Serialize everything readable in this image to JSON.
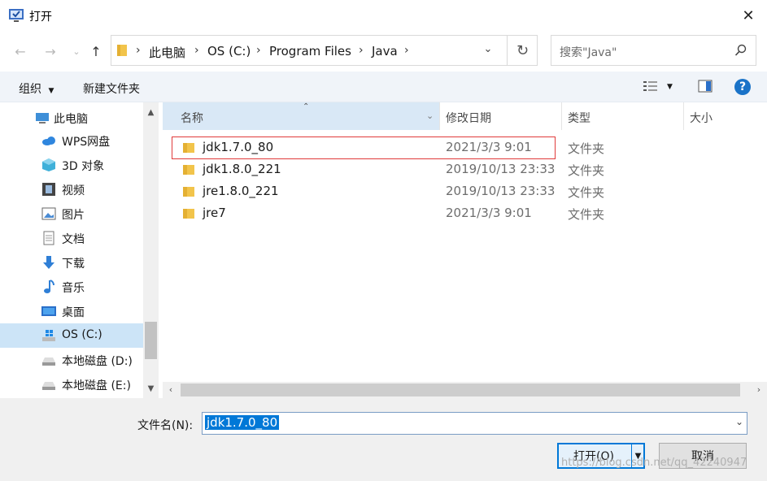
{
  "window": {
    "title": "打开"
  },
  "address": {
    "crumbs": [
      "此电脑",
      "OS (C:)",
      "Program Files",
      "Java"
    ]
  },
  "search": {
    "placeholder": "搜索\"Java\""
  },
  "toolbar": {
    "organize": "组织",
    "new_folder": "新建文件夹"
  },
  "nav_pane": {
    "items": [
      {
        "label": "此电脑",
        "icon": "computer-icon"
      },
      {
        "label": "WPS网盘",
        "icon": "cloud-icon"
      },
      {
        "label": "3D 对象",
        "icon": "cube-icon"
      },
      {
        "label": "视频",
        "icon": "film-icon"
      },
      {
        "label": "图片",
        "icon": "picture-icon"
      },
      {
        "label": "文档",
        "icon": "document-icon"
      },
      {
        "label": "下载",
        "icon": "download-icon"
      },
      {
        "label": "音乐",
        "icon": "music-icon"
      },
      {
        "label": "桌面",
        "icon": "desktop-icon"
      },
      {
        "label": "OS (C:)",
        "icon": "windows-drive-icon"
      },
      {
        "label": "本地磁盘 (D:)",
        "icon": "drive-icon"
      },
      {
        "label": "本地磁盘 (E:)",
        "icon": "drive-icon"
      }
    ],
    "selected": "OS (C:)"
  },
  "columns": {
    "name": "名称",
    "date": "修改日期",
    "type": "类型",
    "size": "大小"
  },
  "files": [
    {
      "name": "jdk1.7.0_80",
      "date": "2021/3/3 9:01",
      "type": "文件夹"
    },
    {
      "name": "jdk1.8.0_221",
      "date": "2019/10/13 23:33",
      "type": "文件夹"
    },
    {
      "name": "jre1.8.0_221",
      "date": "2019/10/13 23:33",
      "type": "文件夹"
    },
    {
      "name": "jre7",
      "date": "2021/3/3 9:01",
      "type": "文件夹"
    }
  ],
  "footer": {
    "filename_label": "文件名(N):",
    "filename_value": "jdk1.7.0_80",
    "open_button": "打开(O)",
    "cancel_button": "取消",
    "watermark": "https://blog.csdn.net/qq_42240947"
  },
  "colors": {
    "accent": "#0078d7",
    "selected_bg": "#cce4f7",
    "focus_outline": "#e03b3b",
    "folder": "#f2c44b"
  }
}
